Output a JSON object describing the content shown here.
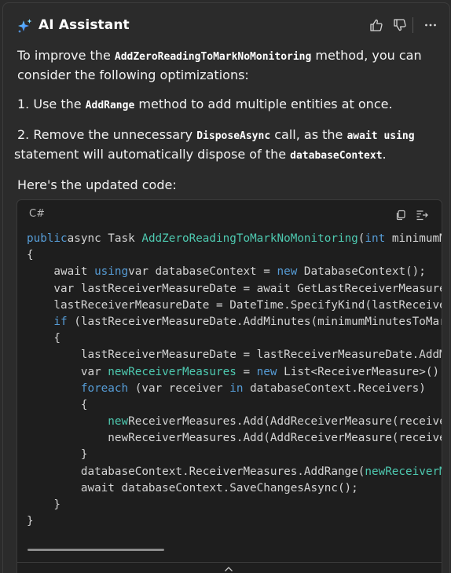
{
  "header": {
    "title": "AI Assistant",
    "icons": [
      "sparkle-icon",
      "thumbs-up-icon",
      "thumbs-down-icon",
      "more-icon"
    ]
  },
  "message": {
    "p1": {
      "before": "To improve the ",
      "code": "AddZeroReadingToMarkNoMonitoring",
      "after": " method, you can consider the following optimizations:"
    },
    "p2": {
      "before": "1. Use the ",
      "code": "AddRange",
      "after": " method to add multiple entities at once."
    },
    "p3": {
      "before": "2. Remove the unnecessary ",
      "code1": "DisposeAsync",
      "mid": " call, as the ",
      "code2": "await using",
      "mid2": " statement will automatically dispose of the ",
      "code3": "databaseContext",
      "after": "."
    },
    "p4": "Here's the updated code:"
  },
  "code_block": {
    "language": "C#",
    "icons": [
      "copy-icon",
      "insert-icon",
      "chevron-up-icon"
    ],
    "lines": [
      [
        [
          "kw",
          "public"
        ],
        [
          "",
          "async Task "
        ],
        [
          "fn",
          "AddZeroReadingToMarkNoMonitoring"
        ],
        [
          "",
          "("
        ],
        [
          "kw",
          "int"
        ],
        [
          "",
          " minimumMinutes"
        ]
      ],
      [
        [
          "",
          "{"
        ]
      ],
      [
        [
          "",
          "    await "
        ],
        [
          "kw",
          "using"
        ],
        [
          "",
          ""
        ],
        [
          "",
          "var databaseContext = "
        ],
        [
          "kw",
          "new"
        ],
        [
          "",
          " DatabaseContext();"
        ]
      ],
      [
        [
          "",
          "    var lastReceiverMeasureDate = await GetLastReceiverMeasureDate();"
        ]
      ],
      [
        [
          "",
          "    lastReceiverMeasureDate = DateTime.SpecifyKind(lastReceiverMeasureDate"
        ]
      ],
      [
        [
          "kw",
          "    if"
        ],
        [
          "",
          " (lastReceiverMeasureDate.AddMinutes(minimumMinutesToMark"
        ]
      ],
      [
        [
          "",
          "    {"
        ]
      ],
      [
        [
          "",
          "        lastReceiverMeasureDate = lastReceiverMeasureDate.AddMinutes"
        ]
      ],
      [
        [
          "",
          "        var "
        ],
        [
          "fn",
          "newReceiverMeasures"
        ],
        [
          "",
          " = "
        ],
        [
          "kw",
          "new"
        ],
        [
          "",
          " List<ReceiverMeasure>();"
        ]
      ],
      [
        [
          "kw",
          "        foreach"
        ],
        [
          "",
          " (var receiver "
        ],
        [
          "kw",
          "in"
        ],
        [
          "",
          " databaseContext.Receivers)"
        ]
      ],
      [
        [
          "",
          "        {"
        ]
      ],
      [
        [
          "",
          "            "
        ],
        [
          "fn",
          "new"
        ],
        [
          "",
          "ReceiverMeasures.Add(AddReceiverMeasure(receiver"
        ]
      ],
      [
        [
          "",
          "            newReceiverMeasures.Add(AddReceiverMeasure(receiver"
        ]
      ],
      [
        [
          "",
          "        }"
        ]
      ],
      [
        [
          "",
          "        databaseContext.ReceiverMeasures.AddRange("
        ],
        [
          "fn",
          "newReceiverMeasures"
        ],
        [
          "",
          ");"
        ]
      ],
      [
        [
          "",
          "        await databaseContext.SaveChangesAsync();"
        ]
      ],
      [
        [
          "",
          "    }"
        ]
      ],
      [
        [
          "",
          "}"
        ]
      ]
    ]
  },
  "colors": {
    "background": "#2b2b2b",
    "code_background": "#1e1e1e",
    "keyword": "#569cd6",
    "identifier": "#4ec9b0",
    "text": "#d4d4d4"
  }
}
